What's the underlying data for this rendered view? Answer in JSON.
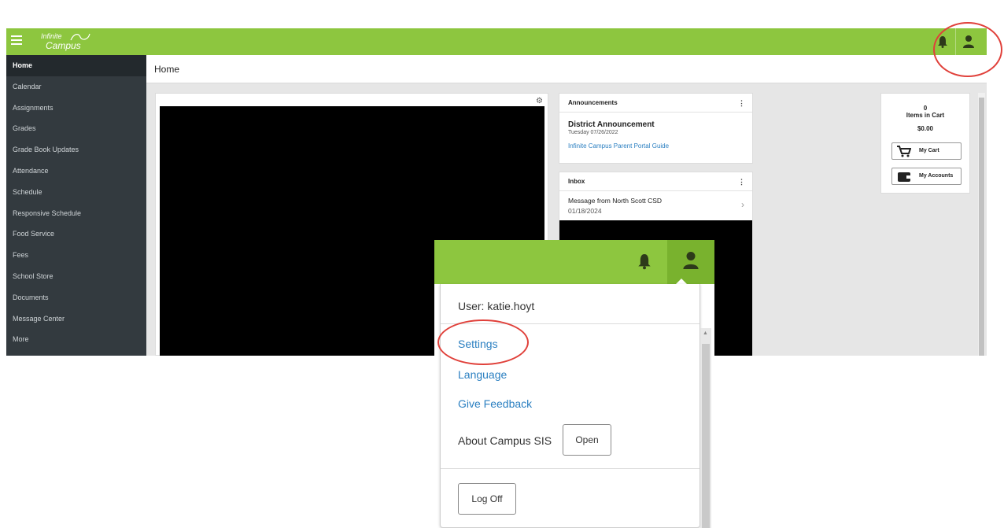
{
  "app": {
    "logo_line1": "Infinite",
    "logo_line2": "Campus"
  },
  "page": {
    "title": "Home"
  },
  "sidebar": {
    "items": [
      {
        "label": "Home",
        "active": true
      },
      {
        "label": "Calendar"
      },
      {
        "label": "Assignments"
      },
      {
        "label": "Grades"
      },
      {
        "label": "Grade Book Updates"
      },
      {
        "label": "Attendance"
      },
      {
        "label": "Schedule"
      },
      {
        "label": "Responsive Schedule"
      },
      {
        "label": "Food Service"
      },
      {
        "label": "Fees"
      },
      {
        "label": "School Store"
      },
      {
        "label": "Documents"
      },
      {
        "label": "Message Center"
      },
      {
        "label": "More"
      }
    ]
  },
  "announcements": {
    "header": "Announcements",
    "title": "District Announcement",
    "date": "Tuesday 07/26/2022",
    "link": "Infinite Campus Parent Portal Guide"
  },
  "inbox": {
    "header": "Inbox",
    "message_title": "Message from North Scott CSD",
    "message_date": "01/18/2024"
  },
  "cart": {
    "count": "0",
    "count_label": "Items in Cart",
    "total": "$0.00",
    "my_cart": "My Cart",
    "my_accounts": "My Accounts"
  },
  "user_menu": {
    "user": "User: katie.hoyt",
    "settings": "Settings",
    "language": "Language",
    "feedback": "Give Feedback",
    "about": "About Campus SIS",
    "open": "Open",
    "logoff": "Log Off"
  },
  "colors": {
    "brand_green": "#8dc63f",
    "sidebar": "#333a3f",
    "link_blue": "#2a7fc1",
    "annotation_red": "#e0403a"
  }
}
